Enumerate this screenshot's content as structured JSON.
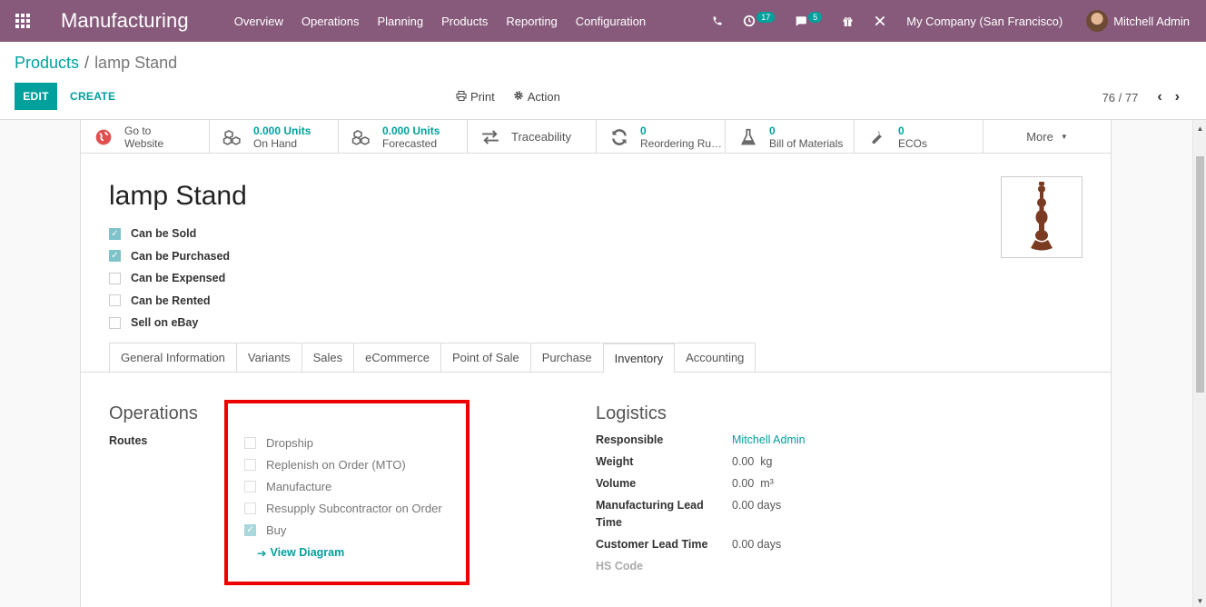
{
  "navbar": {
    "brand": "Manufacturing",
    "menu": [
      "Overview",
      "Operations",
      "Planning",
      "Products",
      "Reporting",
      "Configuration"
    ],
    "activity_badge": "17",
    "messages_badge": "5",
    "company": "My Company (San Francisco)",
    "user": "Mitchell Admin",
    "background": "#875a7b"
  },
  "breadcrumb": {
    "parent": "Products",
    "separator": "/",
    "current": "lamp Stand"
  },
  "toolbar": {
    "edit": "EDIT",
    "create": "CREATE",
    "print": "Print",
    "action": "Action",
    "pager": "76 / 77"
  },
  "smart_buttons": [
    {
      "icon": "globe-icon",
      "value": "Go to",
      "label": "Website"
    },
    {
      "icon": "cubes-icon",
      "value": "0.000 Units",
      "label": "On Hand"
    },
    {
      "icon": "cubes-icon",
      "value": "0.000 Units",
      "label": "Forecasted"
    },
    {
      "icon": "exchange-icon",
      "value": "",
      "label": "Traceability"
    },
    {
      "icon": "refresh-icon",
      "value": "0",
      "label": "Reordering Rules"
    },
    {
      "icon": "flask-icon",
      "value": "0",
      "label": "Bill of Materials"
    },
    {
      "icon": "wrench-icon",
      "value": "0",
      "label": "ECOs"
    },
    {
      "icon": "caret-down-icon",
      "value": "",
      "label": "More"
    }
  ],
  "product": {
    "name": "lamp Stand",
    "flags": [
      {
        "label": "Can be Sold",
        "checked": true
      },
      {
        "label": "Can be Purchased",
        "checked": true
      },
      {
        "label": "Can be Expensed",
        "checked": false
      },
      {
        "label": "Can be Rented",
        "checked": false
      },
      {
        "label": "Sell on eBay",
        "checked": false
      }
    ]
  },
  "tabs": [
    "General Information",
    "Variants",
    "Sales",
    "eCommerce",
    "Point of Sale",
    "Purchase",
    "Inventory",
    "Accounting"
  ],
  "active_tab": "Inventory",
  "operations": {
    "title": "Operations",
    "routes_label": "Routes",
    "routes": [
      {
        "label": "Dropship",
        "checked": false
      },
      {
        "label": "Replenish on Order (MTO)",
        "checked": false
      },
      {
        "label": "Manufacture",
        "checked": false
      },
      {
        "label": "Resupply Subcontractor on Order",
        "checked": false
      },
      {
        "label": "Buy",
        "checked": true
      }
    ],
    "view_diagram": "View Diagram"
  },
  "logistics": {
    "title": "Logistics",
    "responsible_label": "Responsible",
    "responsible": "Mitchell Admin",
    "weight_label": "Weight",
    "weight": "0.00  kg",
    "volume_label": "Volume",
    "volume": "0.00  m³",
    "mfg_lead_label_1": "Manufacturing Lead",
    "mfg_lead_label_2": "Time",
    "mfg_lead": "0.00 days",
    "customer_lead_label": "Customer Lead Time",
    "customer_lead": "0.00 days",
    "hs_code_label": "HS Code"
  }
}
